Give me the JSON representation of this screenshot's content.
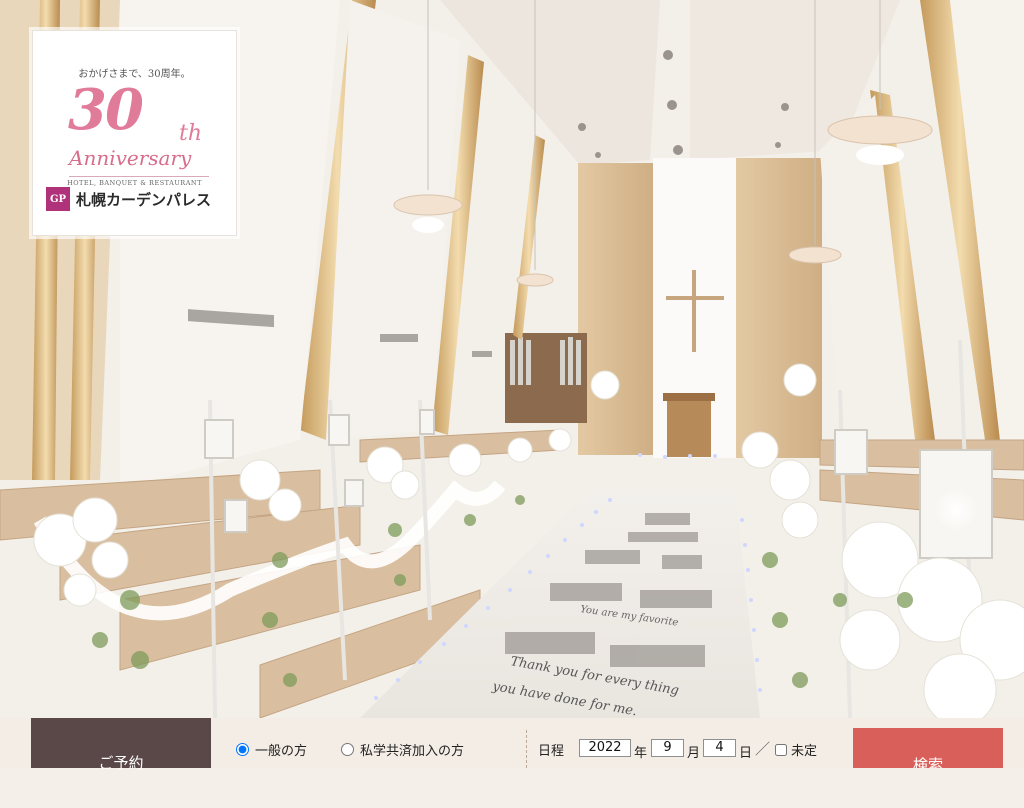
{
  "logo": {
    "tagline": "おかげさまで、30周年。",
    "number": "30",
    "suffix": "th",
    "anniversary": "Anniversary",
    "subtitle": "HOTEL, BANQUET & RESTAURANT",
    "mark": "GP",
    "brand": "札幌カーデンパレス"
  },
  "aisle_text": {
    "line1": "Thank you for every thing",
    "line2": "you have done for me.",
    "line3": "You are my favorite"
  },
  "booking": {
    "reserve_label": "ご予約",
    "options": [
      {
        "label": "一般の方",
        "checked": true
      },
      {
        "label": "私学共済加入の方",
        "checked": false
      }
    ],
    "date_label": "日程",
    "year": "2022",
    "year_unit": "年",
    "month": "9",
    "month_unit": "月",
    "day": "4",
    "day_unit": "日",
    "separator": "／",
    "undecided_label": "未定",
    "search_label": "検索"
  },
  "colors": {
    "reserve_tab": "#5a4747",
    "search_button": "#d9605a",
    "logo_pink": "#e07b9a",
    "brand_mark": "#b0327b"
  }
}
